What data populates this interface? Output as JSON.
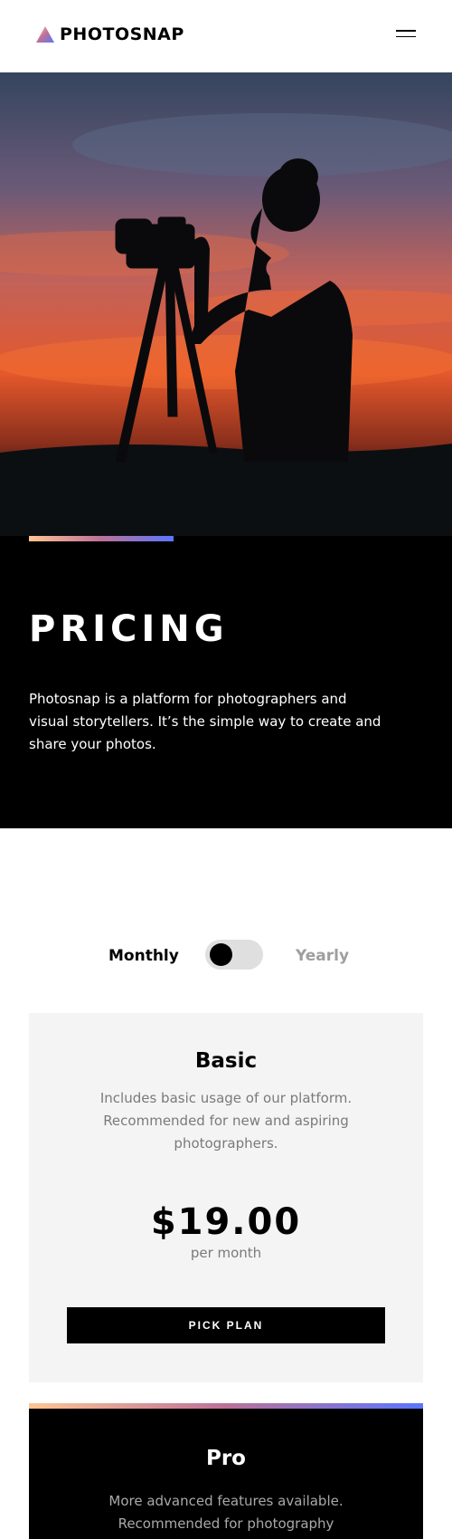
{
  "header": {
    "brand": "PHOTOSNAP",
    "logo_icon": "triangle-logo-icon",
    "menu_icon": "hamburger-menu-icon"
  },
  "hero": {
    "image_alt": "photographer-silhouette-sunset",
    "title": "PRICING",
    "description": "Photosnap is a platform for photographers and visual storytellers. It’s the simple way to create and share your photos."
  },
  "billing_toggle": {
    "monthly_label": "Monthly",
    "yearly_label": "Yearly",
    "selected": "Monthly"
  },
  "plans": [
    {
      "name": "Basic",
      "description": "Includes basic usage of our platform. Recommended for new and aspiring photographers.",
      "price": "$19.00",
      "period": "per month",
      "cta": "PICK PLAN"
    },
    {
      "name": "Pro",
      "description": "More advanced features available. Recommended for photography"
    }
  ],
  "colors": {
    "accent_gradient_start": "#ffc593",
    "accent_gradient_mid": "#bc7198",
    "accent_gradient_end": "#5a77ff",
    "card_background": "#f4f4f4",
    "dark_background": "#000000"
  }
}
